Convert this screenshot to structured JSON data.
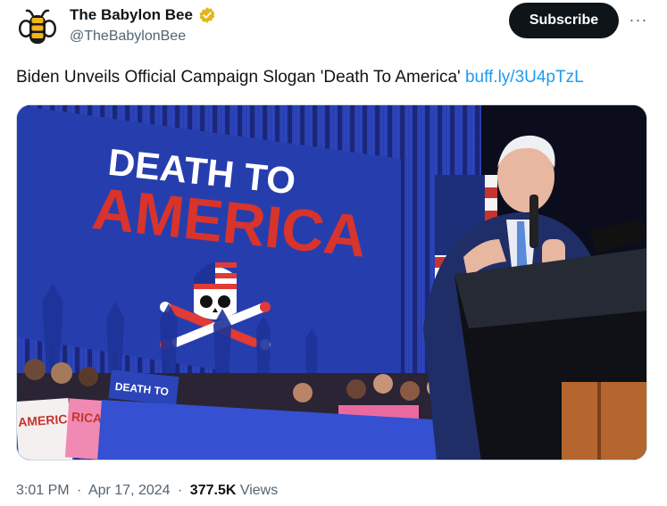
{
  "author": {
    "display_name": "The Babylon Bee",
    "handle": "@TheBabylonBee"
  },
  "actions": {
    "subscribe_label": "Subscribe",
    "more_label": "···"
  },
  "tweet": {
    "text": "Biden Unveils Official Campaign Slogan 'Death To America' ",
    "link_text": "buff.ly/3U4pTzL"
  },
  "image": {
    "sign_line1": "DEATH TO",
    "sign_line2": "AMERICA",
    "placard_left": "AMERICA",
    "placard_mid": "RICA",
    "placard_small": "DEATH TO"
  },
  "meta": {
    "time": "3:01 PM",
    "date": "Apr 17, 2024",
    "views_count": "377.5K",
    "views_label": "Views",
    "separator": "·"
  },
  "colors": {
    "link": "#1d9bf0",
    "subscribe_bg": "#0f1419",
    "verified": "#e2b719",
    "secondary_text": "#536471",
    "sign_red": "#d8342c",
    "backdrop_blue": "#2a3aa0"
  },
  "icons": [
    "babylon-bee-logo-icon",
    "verified-badge-icon",
    "more-options-icon"
  ]
}
